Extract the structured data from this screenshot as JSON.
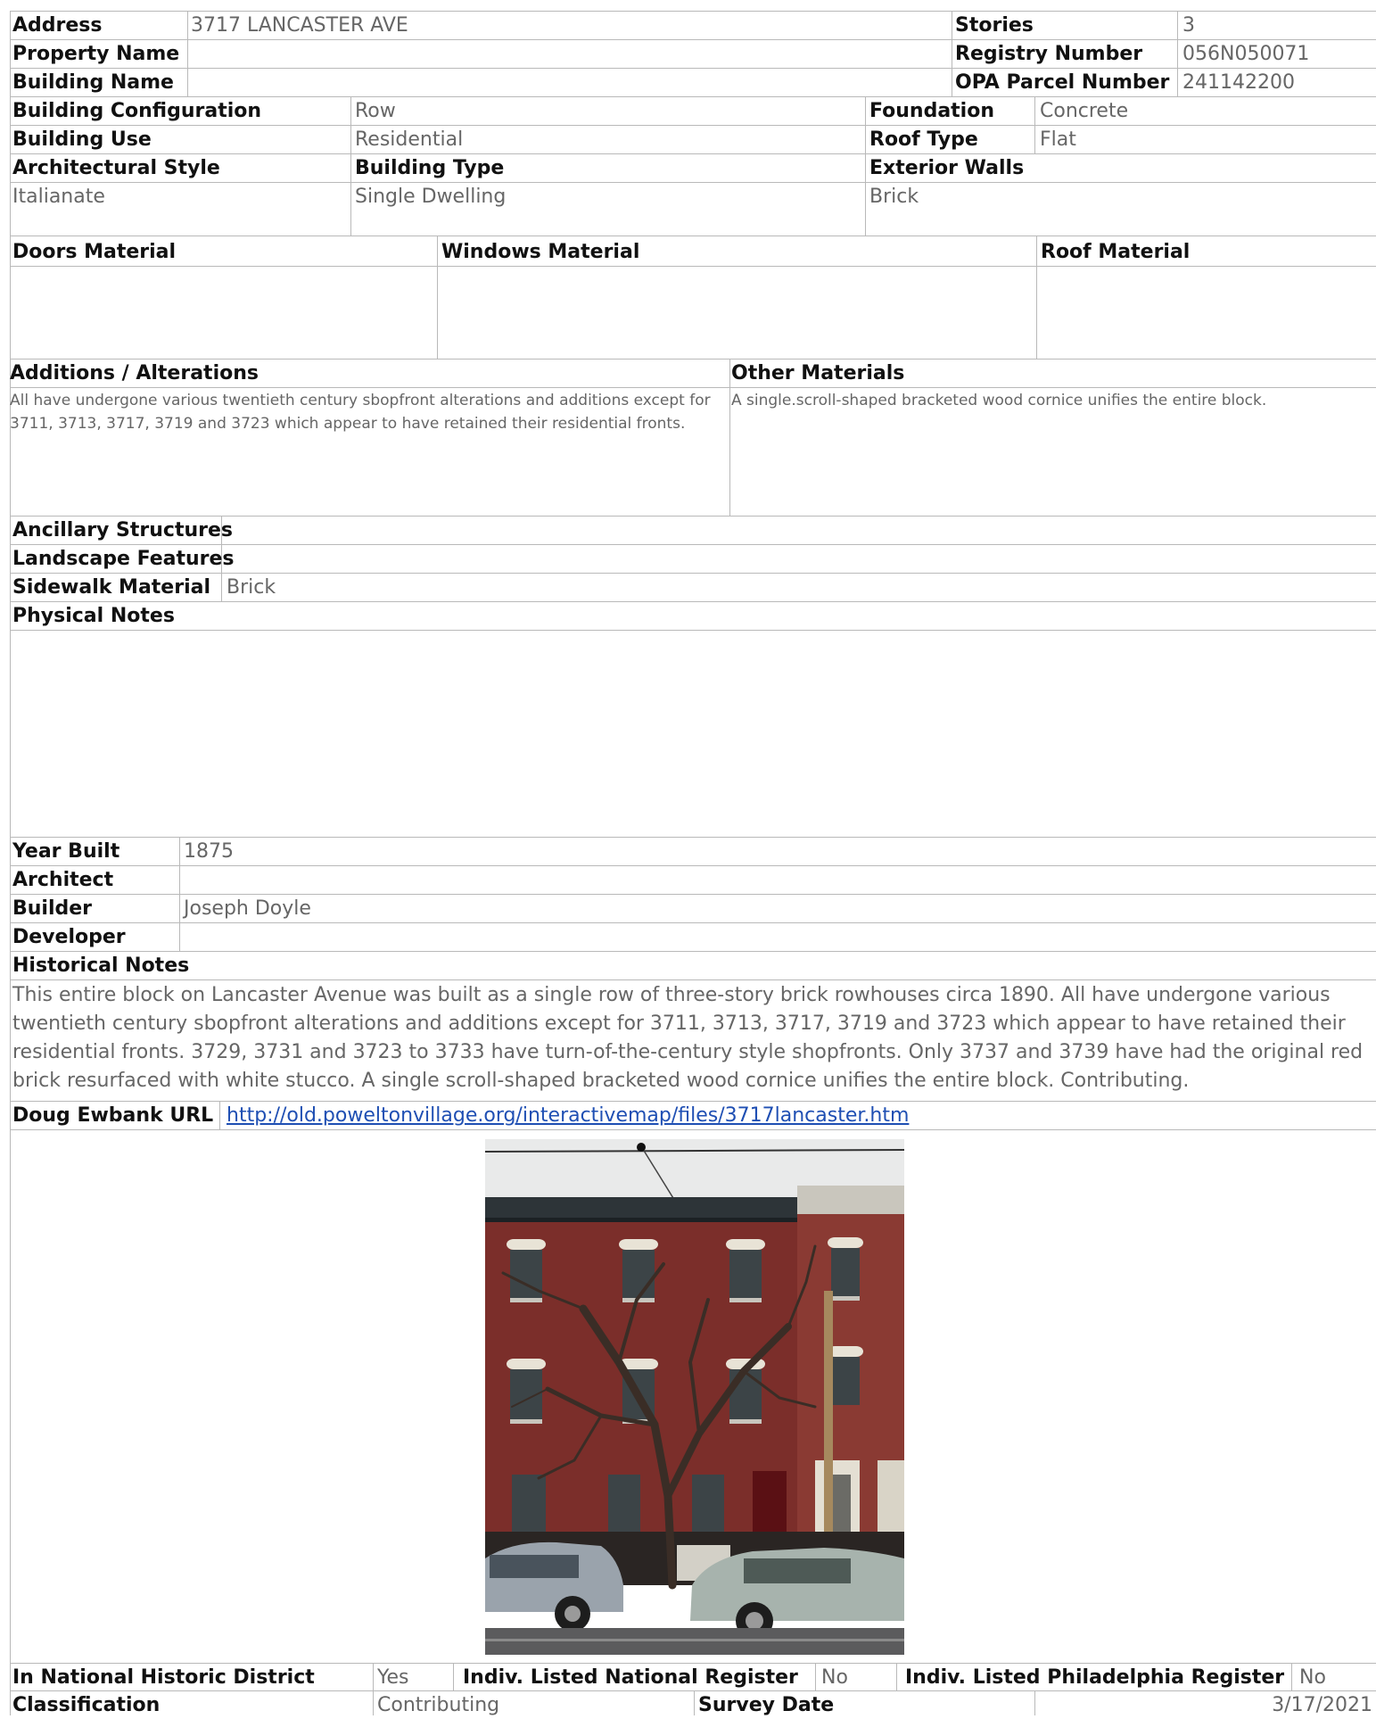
{
  "form": {
    "address_label": "Address",
    "address": "3717 LANCASTER AVE",
    "property_name_label": "Property Name",
    "building_name_label": "Building Name",
    "stories_label": "Stories",
    "stories": "3",
    "registry_label": "Registry Number",
    "registry": "056N050071",
    "opa_label": "OPA Parcel Number",
    "opa": "241142200",
    "config_label": "Building Configuration",
    "config": "Row",
    "use_label": "Building Use",
    "use": "Residential",
    "foundation_label": "Foundation",
    "foundation": "Concrete",
    "roof_type_label": "Roof Type",
    "roof_type": "Flat",
    "arch_style_label": "Architectural Style",
    "arch_style": "Italianate",
    "building_type_label": "Building Type",
    "building_type": "Single Dwelling",
    "exterior_walls_label": "Exterior Walls",
    "exterior_walls": "Brick",
    "doors_label": "Doors Material",
    "windows_label": "Windows Material",
    "roof_material_label": "Roof Material",
    "additions_label": "Additions / Alterations",
    "additions": "All have undergone various twentieth century sbopfront alterations and additions except for 3711, 3713, 3717, 3719 and 3723 which appear to have retained their residential fronts.",
    "other_materials_label": "Other Materials",
    "other_materials": "A single.scroll-shaped bracketed wood cornice unifies the entire block.",
    "ancillary_label": "Ancillary Structures",
    "landscape_label": "Landscape Features",
    "sidewalk_label": "Sidewalk Material",
    "sidewalk": "Brick",
    "physical_notes_label": "Physical Notes",
    "year_built_label": "Year Built",
    "year_built": "1875",
    "architect_label": "Architect",
    "builder_label": "Builder",
    "builder": "Joseph Doyle",
    "developer_label": "Developer",
    "historical_notes_label": "Historical Notes",
    "historical_notes": "This entire block on Lancaster Avenue was built as a single row of three-story brick rowhouses circa 1890. All have undergone various twentieth century sbopfront alterations and additions except for 3711, 3713, 3717, 3719 and 3723 which appear to have retained their residential fronts. 3729, 3731 and 3723 to 3733 have turn-of-the-century style shopfronts. Only 3737 and 3739 have had the original red brick resurfaced with white stucco. A single scroll-shaped bracketed wood cornice unifies the entire block. Contributing.",
    "ewbank_label": "Doug Ewbank URL",
    "ewbank_url": "http://old.poweltonvillage.org/interactivemap/files/3717lancaster.htm",
    "national_district_label": "In National Historic District",
    "national_district": "Yes",
    "indiv_national_label": "Indiv. Listed National Register",
    "indiv_national": "No",
    "indiv_phila_label": "Indiv. Listed Philadelphia Register",
    "indiv_phila": "No",
    "classification_label": "Classification",
    "classification": "Contributing",
    "survey_date_label": "Survey Date",
    "survey_date": "3/17/2021"
  },
  "colors": {
    "grid": "#b9b9b9",
    "label": "#111111",
    "value": "#666666",
    "link": "#1f4fb3"
  }
}
